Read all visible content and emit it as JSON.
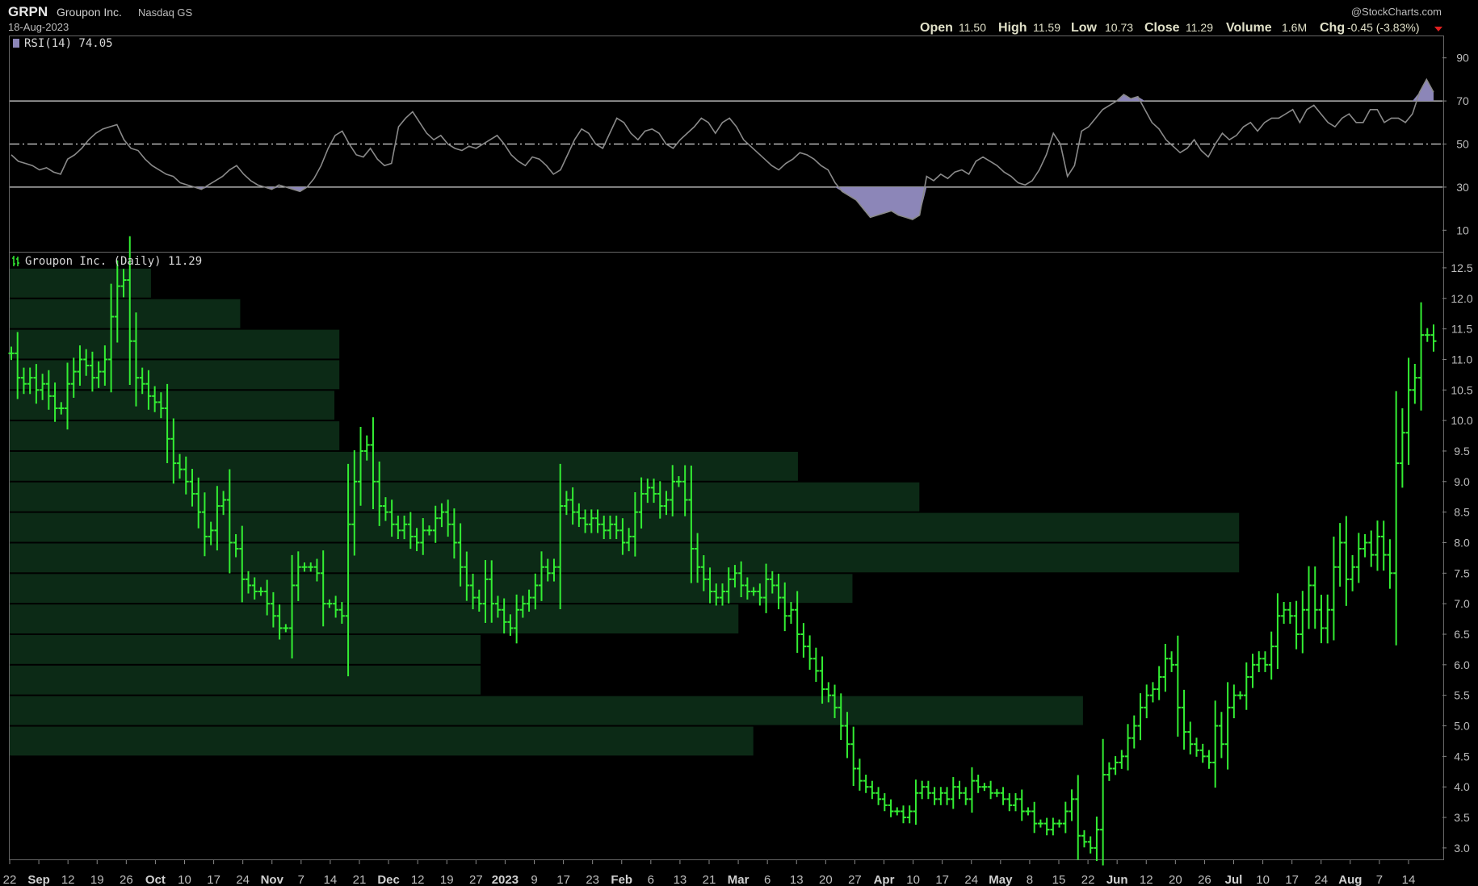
{
  "header": {
    "symbol": "GRPN",
    "company": "Groupon Inc.",
    "exchange": "Nasdaq GS",
    "date": "18-Aug-2023",
    "watermark": "@StockCharts.com",
    "ohlc": {
      "open_label": "Open",
      "open": "11.50",
      "high_label": "High",
      "high": "11.59",
      "low_label": "Low",
      "low": "10.73",
      "close_label": "Close",
      "close": "11.29",
      "volume_label": "Volume",
      "volume": "1.6M",
      "chg_label": "Chg",
      "chg": "-0.45 (-3.83%)"
    }
  },
  "colors": {
    "background": "#000000",
    "price_bar": "#33ee33",
    "rsi_line": "#8a8a8a",
    "rsi_fill": "#8c86b8",
    "volume_by_price": "#0c2a16",
    "grid_line": "#d8d8d8",
    "down_arrow": "#e02020"
  },
  "rsi_panel": {
    "label": "RSI(14) 74.05",
    "levels": [
      "90",
      "70",
      "50",
      "30",
      "10"
    ]
  },
  "price_panel": {
    "label": "Groupon Inc. (Daily) 11.29",
    "y_ticks": [
      "12.5",
      "12.0",
      "11.5",
      "11.0",
      "10.5",
      "10.0",
      "9.5",
      "9.0",
      "8.5",
      "8.0",
      "7.5",
      "7.0",
      "6.5",
      "6.0",
      "5.5",
      "5.0",
      "4.5",
      "4.0",
      "3.5",
      "3.0"
    ]
  },
  "x_axis": {
    "ticks": [
      {
        "label": "22",
        "bold": false
      },
      {
        "label": "Sep",
        "bold": true
      },
      {
        "label": "12",
        "bold": false
      },
      {
        "label": "19",
        "bold": false
      },
      {
        "label": "26",
        "bold": false
      },
      {
        "label": "Oct",
        "bold": true
      },
      {
        "label": "10",
        "bold": false
      },
      {
        "label": "17",
        "bold": false
      },
      {
        "label": "24",
        "bold": false
      },
      {
        "label": "Nov",
        "bold": true
      },
      {
        "label": "7",
        "bold": false
      },
      {
        "label": "14",
        "bold": false
      },
      {
        "label": "21",
        "bold": false
      },
      {
        "label": "Dec",
        "bold": true
      },
      {
        "label": "12",
        "bold": false
      },
      {
        "label": "19",
        "bold": false
      },
      {
        "label": "27",
        "bold": false
      },
      {
        "label": "2023",
        "bold": true
      },
      {
        "label": "9",
        "bold": false
      },
      {
        "label": "17",
        "bold": false
      },
      {
        "label": "23",
        "bold": false
      },
      {
        "label": "Feb",
        "bold": true
      },
      {
        "label": "6",
        "bold": false
      },
      {
        "label": "13",
        "bold": false
      },
      {
        "label": "21",
        "bold": false
      },
      {
        "label": "Mar",
        "bold": true
      },
      {
        "label": "6",
        "bold": false
      },
      {
        "label": "13",
        "bold": false
      },
      {
        "label": "20",
        "bold": false
      },
      {
        "label": "27",
        "bold": false
      },
      {
        "label": "Apr",
        "bold": true
      },
      {
        "label": "10",
        "bold": false
      },
      {
        "label": "17",
        "bold": false
      },
      {
        "label": "24",
        "bold": false
      },
      {
        "label": "May",
        "bold": true
      },
      {
        "label": "8",
        "bold": false
      },
      {
        "label": "15",
        "bold": false
      },
      {
        "label": "22",
        "bold": false
      },
      {
        "label": "Jun",
        "bold": true
      },
      {
        "label": "12",
        "bold": false
      },
      {
        "label": "20",
        "bold": false
      },
      {
        "label": "26",
        "bold": false
      },
      {
        "label": "Jul",
        "bold": true
      },
      {
        "label": "10",
        "bold": false
      },
      {
        "label": "17",
        "bold": false
      },
      {
        "label": "24",
        "bold": false
      },
      {
        "label": "Aug",
        "bold": true
      },
      {
        "label": "7",
        "bold": false
      },
      {
        "label": "14",
        "bold": false
      }
    ]
  },
  "chart_data": {
    "type": "line",
    "series": [
      {
        "name": "RSI(14)",
        "values": [
          45,
          42,
          41,
          40,
          38,
          39,
          37,
          36,
          43,
          45,
          48,
          52,
          55,
          57,
          58,
          59,
          52,
          48,
          47,
          43,
          40,
          38,
          36,
          35,
          32,
          31,
          30,
          29,
          31,
          33,
          35,
          38,
          40,
          36,
          33,
          31,
          30,
          29,
          31,
          30,
          29,
          28,
          30,
          34,
          40,
          48,
          54,
          56,
          50,
          45,
          44,
          48,
          43,
          40,
          41,
          58,
          62,
          65,
          60,
          55,
          52,
          54,
          50,
          48,
          47,
          49,
          48,
          50,
          52,
          54,
          50,
          45,
          42,
          40,
          44,
          43,
          40,
          36,
          38,
          45,
          52,
          57,
          55,
          50,
          48,
          55,
          62,
          60,
          55,
          52,
          56,
          57,
          55,
          50,
          48,
          52,
          55,
          58,
          62,
          60,
          55,
          60,
          62,
          58,
          52,
          49,
          46,
          43,
          40,
          38,
          41,
          43,
          46,
          45,
          43,
          40,
          38,
          32,
          28,
          26,
          24,
          20,
          16,
          17,
          18,
          19,
          17,
          16,
          15,
          17,
          35,
          33,
          36,
          34,
          37,
          38,
          36,
          42,
          44,
          42,
          40,
          37,
          35,
          32,
          31,
          33,
          38,
          45,
          55,
          50,
          35,
          40,
          56,
          58,
          62,
          66,
          68,
          70,
          73,
          71,
          72,
          66,
          60,
          57,
          52,
          49,
          46,
          48,
          52,
          47,
          44,
          50,
          55,
          52,
          54,
          58,
          60,
          56,
          60,
          62,
          62,
          64,
          66,
          60,
          66,
          68,
          64,
          60,
          58,
          62,
          64,
          60,
          60,
          66,
          66,
          60,
          62,
          62,
          60,
          64,
          74,
          80,
          74
        ]
      },
      {
        "name": "Groupon Inc. (Daily)",
        "values": [
          11.1,
          10.7,
          10.6,
          10.7,
          10.5,
          10.6,
          10.4,
          10.2,
          10.2,
          10.6,
          10.8,
          11.0,
          10.9,
          10.7,
          10.8,
          11.0,
          11.7,
          12.2,
          12.3,
          11.3,
          10.7,
          10.6,
          10.4,
          10.3,
          10.2,
          9.7,
          9.3,
          9.2,
          9.0,
          8.8,
          8.5,
          8.1,
          8.2,
          8.6,
          8.7,
          8.0,
          7.9,
          7.4,
          7.3,
          7.2,
          7.2,
          7.0,
          6.8,
          6.6,
          6.6,
          7.3,
          7.6,
          7.6,
          7.6,
          7.5,
          7.0,
          7.0,
          6.9,
          6.8,
          8.3,
          9.0,
          9.5,
          9.6,
          9.0,
          8.6,
          8.5,
          8.3,
          8.2,
          8.3,
          8.1,
          8.0,
          8.2,
          8.2,
          8.4,
          8.5,
          8.3,
          8.0,
          7.6,
          7.3,
          7.1,
          7.0,
          7.4,
          7.0,
          6.9,
          6.7,
          6.6,
          6.9,
          7.0,
          7.1,
          7.3,
          7.6,
          7.5,
          7.6,
          8.6,
          8.7,
          8.5,
          8.4,
          8.3,
          8.4,
          8.3,
          8.2,
          8.3,
          8.2,
          8.0,
          8.1,
          8.5,
          8.8,
          8.9,
          8.8,
          8.6,
          8.7,
          9.0,
          9.0,
          8.7,
          7.9,
          7.6,
          7.4,
          7.2,
          7.1,
          7.2,
          7.4,
          7.5,
          7.3,
          7.2,
          7.2,
          7.1,
          7.4,
          7.3,
          7.1,
          6.8,
          6.9,
          6.5,
          6.3,
          6.1,
          5.9,
          5.6,
          5.5,
          5.3,
          5.0,
          4.7,
          4.3,
          4.1,
          4.0,
          3.9,
          3.8,
          3.7,
          3.6,
          3.6,
          3.5,
          3.6,
          3.9,
          4.0,
          3.9,
          3.8,
          3.9,
          3.8,
          4.0,
          3.9,
          3.8,
          4.1,
          4.0,
          4.0,
          3.9,
          3.9,
          3.8,
          3.7,
          3.8,
          3.6,
          3.6,
          3.4,
          3.4,
          3.3,
          3.4,
          3.4,
          3.6,
          3.8,
          3.2,
          3.1,
          3.0,
          3.3,
          4.2,
          4.3,
          4.4,
          4.5,
          4.8,
          5.0,
          5.3,
          5.5,
          5.6,
          5.8,
          6.1,
          6.0,
          5.3,
          4.9,
          4.7,
          4.6,
          4.5,
          4.4,
          5.0,
          4.7,
          5.3,
          5.5,
          5.5,
          5.8,
          6.0,
          6.1,
          6.0,
          6.3,
          6.8,
          6.9,
          6.8,
          6.5,
          6.9,
          7.3,
          6.9,
          6.6,
          6.9,
          7.6,
          8.0,
          7.4,
          7.6,
          7.9,
          8.0,
          7.8,
          8.1,
          7.8,
          7.5,
          9.3,
          9.8,
          10.5,
          10.7,
          11.4,
          11.4,
          11.3
        ]
      }
    ],
    "volume_by_price": [
      {
        "low": 12.0,
        "high": 12.5,
        "relative": 0.057
      },
      {
        "low": 11.5,
        "high": 12.0,
        "relative": 0.093
      },
      {
        "low": 11.0,
        "high": 11.5,
        "relative": 0.133
      },
      {
        "low": 10.5,
        "high": 11.0,
        "relative": 0.133
      },
      {
        "low": 10.0,
        "high": 10.5,
        "relative": 0.131
      },
      {
        "low": 9.5,
        "high": 10.0,
        "relative": 0.133
      },
      {
        "low": 9.0,
        "high": 9.5,
        "relative": 0.318
      },
      {
        "low": 8.5,
        "high": 9.0,
        "relative": 0.367
      },
      {
        "low": 8.0,
        "high": 8.5,
        "relative": 0.496
      },
      {
        "low": 7.5,
        "high": 8.0,
        "relative": 0.496
      },
      {
        "low": 7.0,
        "high": 7.5,
        "relative": 0.34
      },
      {
        "low": 6.5,
        "high": 7.0,
        "relative": 0.294
      },
      {
        "low": 6.0,
        "high": 6.5,
        "relative": 0.19
      },
      {
        "low": 5.5,
        "high": 6.0,
        "relative": 0.19
      },
      {
        "low": 5.0,
        "high": 5.5,
        "relative": 0.433
      },
      {
        "low": 4.5,
        "high": 5.0,
        "relative": 0.3
      }
    ],
    "rsi_ylim": [
      0,
      100
    ],
    "price_ylim": [
      2.8,
      12.75
    ],
    "grid": false
  }
}
